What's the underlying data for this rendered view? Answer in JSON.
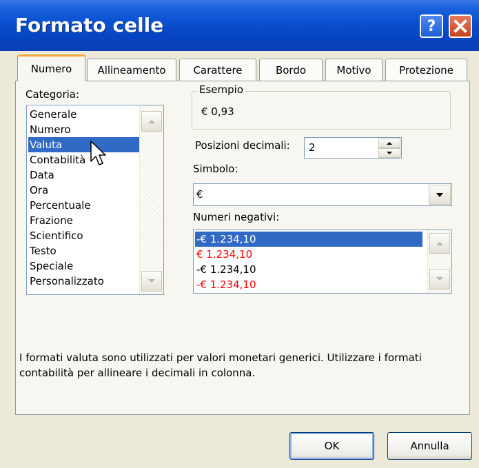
{
  "dialog": {
    "title": "Formato celle",
    "help_label": "?",
    "ok_label": "OK",
    "cancel_label": "Annulla"
  },
  "tabs": [
    {
      "label": "Numero",
      "active": true
    },
    {
      "label": "Allineamento"
    },
    {
      "label": "Carattere"
    },
    {
      "label": "Bordo"
    },
    {
      "label": "Motivo"
    },
    {
      "label": "Protezione"
    }
  ],
  "category": {
    "label": "Categoria:",
    "items": [
      "Generale",
      "Numero",
      "Valuta",
      "Contabilità",
      "Data",
      "Ora",
      "Percentuale",
      "Frazione",
      "Scientifico",
      "Testo",
      "Speciale",
      "Personalizzato"
    ],
    "selected": "Valuta"
  },
  "example": {
    "legend": "Esempio",
    "value": "€ 0,93"
  },
  "decimals": {
    "label": "Posizioni decimali:",
    "value": "2"
  },
  "symbol": {
    "label": "Simbolo:",
    "value": "€"
  },
  "negatives": {
    "label": "Numeri negativi:",
    "items": [
      {
        "text": "-€ 1.234,10",
        "color": "#000000",
        "selected": true
      },
      {
        "text": "€ 1.234,10",
        "color": "#ff0000"
      },
      {
        "text": "-€ 1.234,10",
        "color": "#000000"
      },
      {
        "text": "-€ 1.234,10",
        "color": "#ff0000"
      }
    ]
  },
  "description": "I formati valuta sono utilizzati per valori  monetari generici. Utilizzare i formati contabilità per allineare i decimali in colonna.",
  "colors": {
    "titlebar": "#0a4fcf",
    "selection": "#316ac5",
    "active_tab_accent": "#f4a93b",
    "negative_red": "#ff0000"
  }
}
